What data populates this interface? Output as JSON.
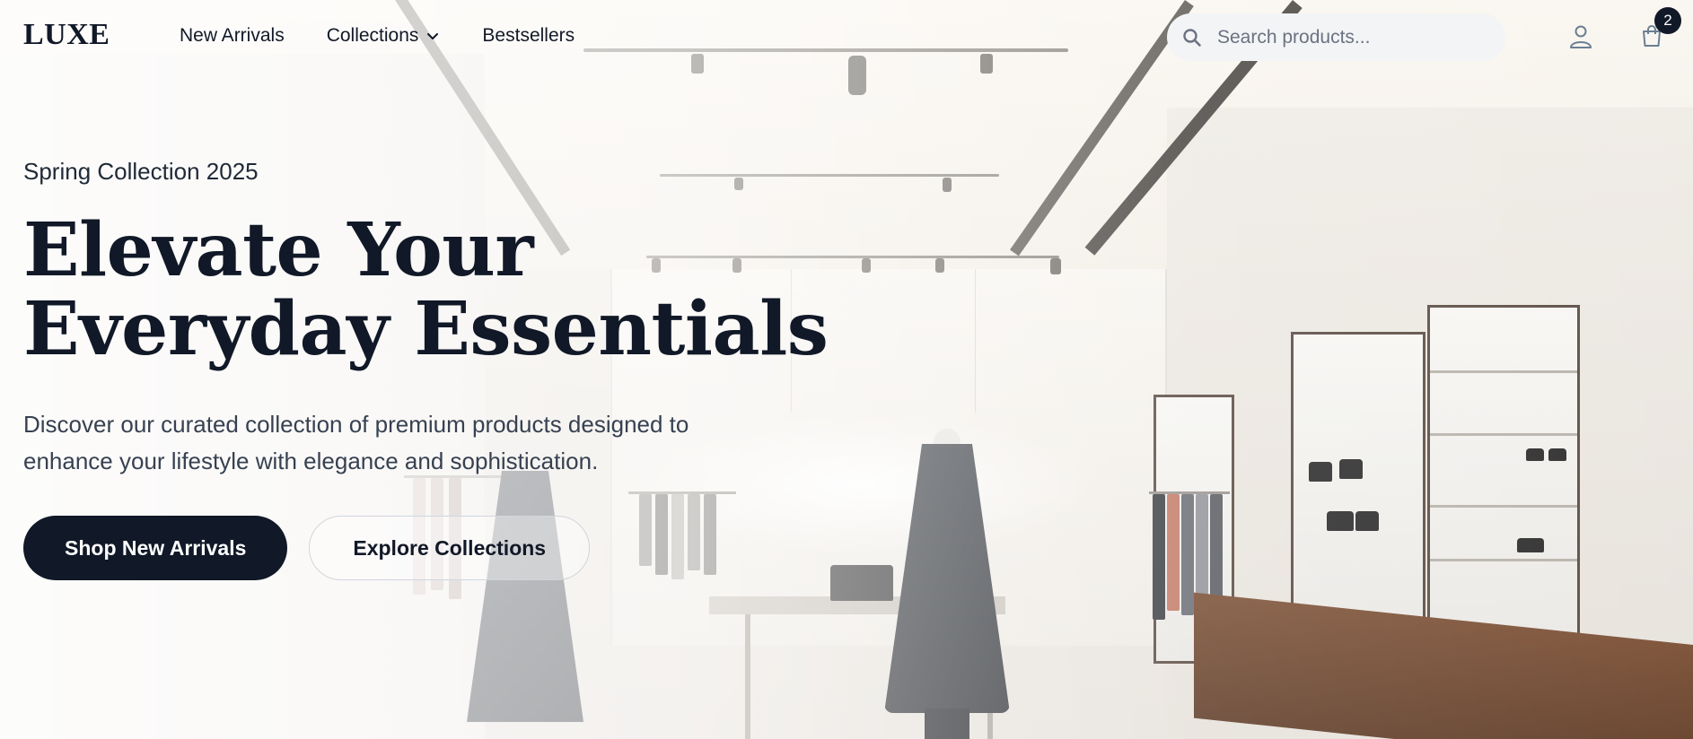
{
  "header": {
    "logo": "LUXE",
    "nav": [
      {
        "label": "New Arrivals"
      },
      {
        "label": "Collections"
      },
      {
        "label": "Bestsellers"
      }
    ],
    "search": {
      "placeholder": "Search products..."
    },
    "cart_count": "2",
    "icons": {
      "search": "search-icon",
      "user": "user-icon",
      "cart": "shopping-bag-icon",
      "dropdown": "chevron-down-icon"
    }
  },
  "hero": {
    "eyebrow": "Spring Collection 2025",
    "headline_line1": "Elevate Your",
    "headline_line2": "Everyday Essentials",
    "subtext": "Discover our curated collection of premium products designed to enhance your lifestyle with elegance and sophistication.",
    "primary_cta": "Shop New Arrivals",
    "secondary_cta": "Explore Collections"
  },
  "colors": {
    "primary": "#111827",
    "search_bg": "#f3f4f6",
    "muted_text": "#374151"
  }
}
